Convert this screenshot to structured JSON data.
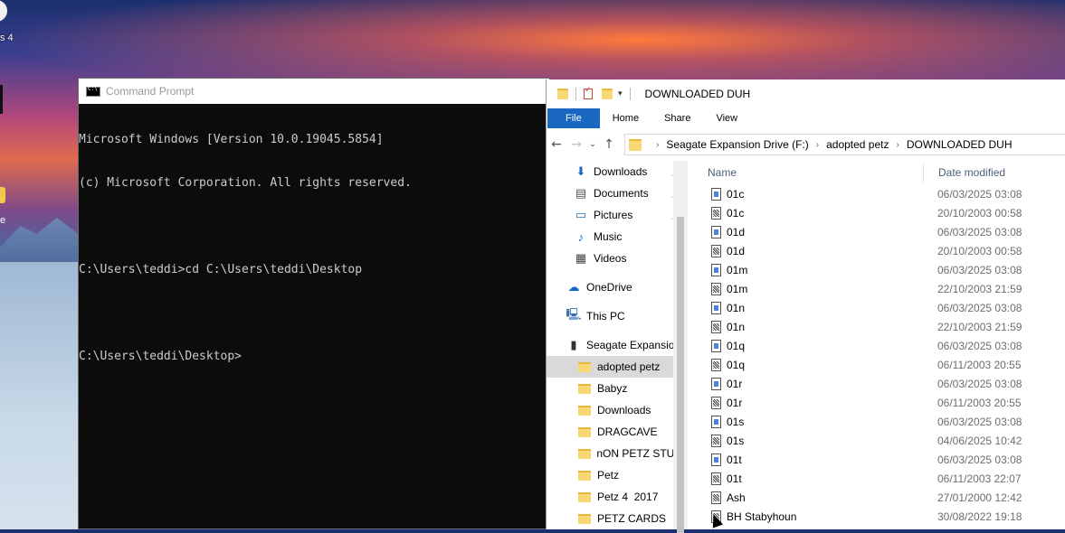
{
  "desktop": {
    "icon_label_fragment": "s 4",
    "icon_label_fragment2": "e"
  },
  "cmd": {
    "title": "Command Prompt",
    "lines": [
      "Microsoft Windows [Version 10.0.19045.5854]",
      "(c) Microsoft Corporation. All rights reserved.",
      "",
      "C:\\Users\\teddi>cd C:\\Users\\teddi\\Desktop",
      "",
      "C:\\Users\\teddi\\Desktop>"
    ]
  },
  "explorer": {
    "title": "DOWNLOADED DUH",
    "ribbon_tabs": [
      "File",
      "Home",
      "Share",
      "View"
    ],
    "breadcrumb": [
      "Seagate Expansion Drive (F:)",
      "adopted petz",
      "DOWNLOADED DUH"
    ],
    "nav_pane": {
      "quick_access": [
        {
          "label": "Downloads",
          "icon": "download-icon",
          "pinned": true
        },
        {
          "label": "Documents",
          "icon": "documents-icon",
          "pinned": true
        },
        {
          "label": "Pictures",
          "icon": "pictures-icon",
          "pinned": true
        },
        {
          "label": "Music",
          "icon": "music-icon",
          "pinned": false
        },
        {
          "label": "Videos",
          "icon": "videos-icon",
          "pinned": false
        }
      ],
      "onedrive": "OneDrive",
      "this_pc": "This PC",
      "drive": "Seagate Expansion",
      "folders": [
        "adopted petz",
        "Babyz",
        "Downloads",
        "DRAGCAVE",
        "nON PETZ STUFF",
        "Petz",
        "Petz 4  2017",
        "PETZ CARDS"
      ],
      "selected_folder": "adopted petz"
    },
    "columns": {
      "name": "Name",
      "date": "Date modified"
    },
    "files": [
      {
        "name": "01c",
        "date": "06/03/2025 03:08",
        "icon": "doc"
      },
      {
        "name": "01c",
        "date": "20/10/2003 00:58",
        "icon": "pic"
      },
      {
        "name": "01d",
        "date": "06/03/2025 03:08",
        "icon": "doc"
      },
      {
        "name": "01d",
        "date": "20/10/2003 00:58",
        "icon": "pic"
      },
      {
        "name": "01m",
        "date": "06/03/2025 03:08",
        "icon": "doc"
      },
      {
        "name": "01m",
        "date": "22/10/2003 21:59",
        "icon": "pic"
      },
      {
        "name": "01n",
        "date": "06/03/2025 03:08",
        "icon": "doc"
      },
      {
        "name": "01n",
        "date": "22/10/2003 21:59",
        "icon": "pic"
      },
      {
        "name": "01q",
        "date": "06/03/2025 03:08",
        "icon": "doc"
      },
      {
        "name": "01q",
        "date": "06/11/2003 20:55",
        "icon": "pic"
      },
      {
        "name": "01r",
        "date": "06/03/2025 03:08",
        "icon": "doc"
      },
      {
        "name": "01r",
        "date": "06/11/2003 20:55",
        "icon": "pic"
      },
      {
        "name": "01s",
        "date": "06/03/2025 03:08",
        "icon": "doc"
      },
      {
        "name": "01s",
        "date": "04/06/2025 10:42",
        "icon": "pic"
      },
      {
        "name": "01t",
        "date": "06/03/2025 03:08",
        "icon": "doc"
      },
      {
        "name": "01t",
        "date": "06/11/2003 22:07",
        "icon": "pic"
      },
      {
        "name": "Ash",
        "date": "27/01/2000 12:42",
        "icon": "pic"
      },
      {
        "name": "BH Stabyhoun",
        "date": "30/08/2022 19:18",
        "icon": "pic"
      }
    ]
  }
}
